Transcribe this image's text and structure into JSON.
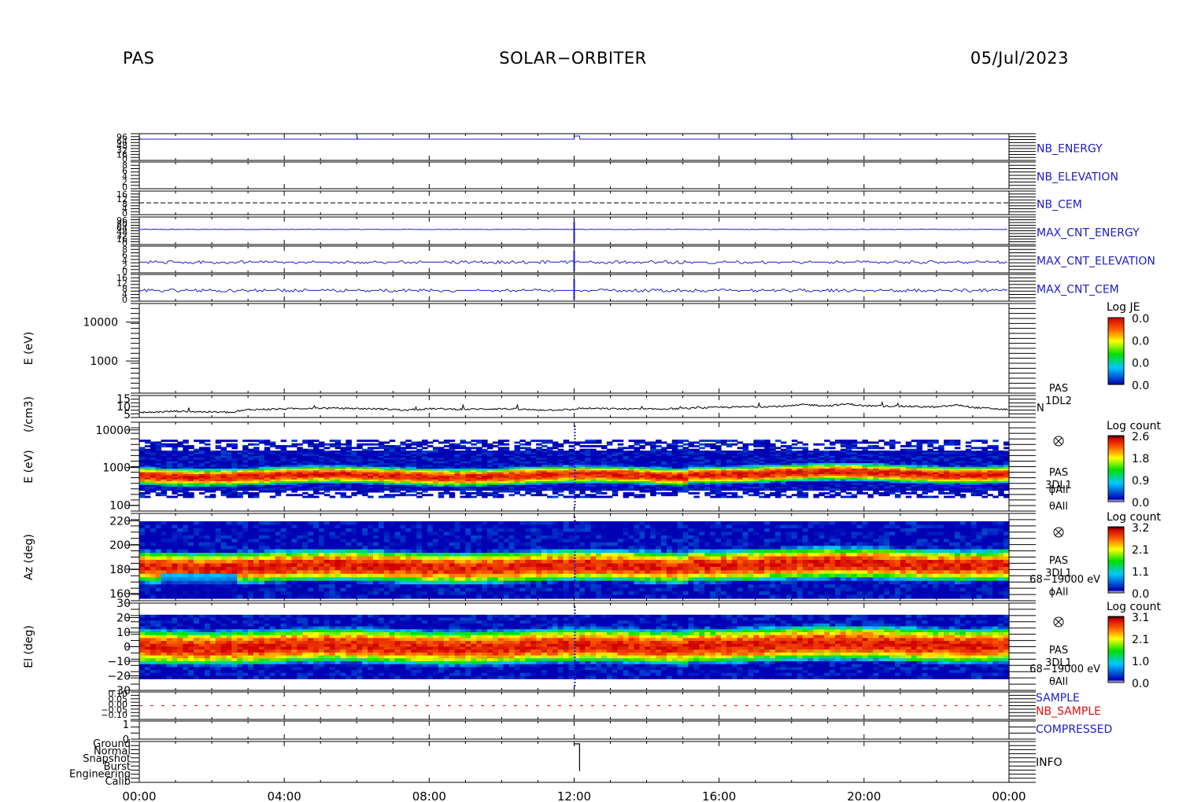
{
  "header": {
    "left": "PAS",
    "center": "SOLAR−ORBITER",
    "right": "05/Jul/2023"
  },
  "colors": {
    "blue": "#1c1cc8",
    "red": "#e01010",
    "black": "#000000"
  },
  "chart_data": {
    "type": "stacked-timeseries-spectrogram",
    "x_axis": {
      "start": "00:00",
      "end": "24:00",
      "tick_labels": [
        "00:00",
        "04:00",
        "08:00",
        "12:00",
        "16:00",
        "20:00",
        "00:00"
      ],
      "tick_hours": [
        0,
        4,
        8,
        12,
        16,
        20,
        24
      ]
    },
    "line_panels": [
      {
        "id": "nb-energy",
        "label": "NB_ENERGY",
        "label_color": "#1c1cc8",
        "ticks": [
          "96",
          "64",
          "48",
          "32",
          "16",
          "0"
        ],
        "series_color": "#1c1cc8",
        "points": [
          [
            0.0,
            1.0
          ],
          [
            0.02,
            0.0
          ],
          [
            6.0,
            0.0
          ],
          [
            6.01,
            1.0
          ],
          [
            6.02,
            0.0
          ],
          [
            12.0,
            0.0
          ],
          [
            12.01,
            1.0
          ],
          [
            12.15,
            1.0
          ],
          [
            12.16,
            0.0
          ],
          [
            18.0,
            0.0
          ],
          [
            18.01,
            1.0
          ],
          [
            18.02,
            0.0
          ],
          [
            24.0,
            0.0
          ]
        ]
      },
      {
        "id": "nb-elevation",
        "label": "NB_ELEVATION",
        "label_color": "#1c1cc8",
        "ticks": [
          "8",
          "6",
          "4",
          "2",
          "0"
        ],
        "series_color": "#1c1cc8",
        "points": []
      },
      {
        "id": "nb-cem",
        "label": "NB_CEM",
        "label_color": "#1c1cc8",
        "ticks": [
          "16",
          "12",
          "8",
          "4",
          "0"
        ],
        "series_color": "#000000",
        "dashed_level": 0.5,
        "points": []
      },
      {
        "id": "max-cnt-energy",
        "label": "MAX_CNT_ENERGY",
        "label_color": "#1c1cc8",
        "ticks": [
          "96",
          "80",
          "64",
          "48",
          "32",
          "16",
          "0"
        ],
        "series_color": "#1c1cc8",
        "base_level": 0.55,
        "spike_hour": 12.0
      },
      {
        "id": "max-cnt-elevation",
        "label": "MAX_CNT_ELEVATION",
        "label_color": "#1c1cc8",
        "ticks": [
          "8",
          "6",
          "4",
          "2",
          "0"
        ],
        "series_color": "#1c1cc8",
        "base_level": 0.4,
        "spike_hour": 12.0
      },
      {
        "id": "max-cnt-cem",
        "label": "MAX_CNT_CEM",
        "label_color": "#1c1cc8",
        "ticks": [
          "16",
          "12",
          "8",
          "4",
          "0"
        ],
        "series_color": "#1c1cc8",
        "base_level": 0.4,
        "spike_hour": 12.0
      }
    ],
    "je_panel": {
      "ylabel": "E (eV)",
      "yscale": "log",
      "ylim": [
        150,
        30000
      ],
      "ytick_labels": [
        "1000",
        "10000"
      ],
      "ytick_values": [
        1000,
        10000
      ],
      "colorbar": {
        "title": "Log JE",
        "labels": [
          "0.0",
          "0.0",
          "0.0",
          "0.0"
        ]
      }
    },
    "density_panel": {
      "ylabel": "(/cm3)",
      "ylim": [
        3,
        17
      ],
      "ytick_values": [
        5,
        10,
        15
      ],
      "ytick_labels": [
        "5",
        "10",
        "15"
      ],
      "right_labels": [
        "PAS",
        "1DL2",
        "N"
      ],
      "x": [
        0,
        1,
        2,
        2.6,
        3,
        4,
        5,
        6,
        7,
        7.3,
        8,
        9,
        10,
        11,
        12,
        12.1,
        13,
        14,
        15,
        16,
        17,
        18,
        18.3,
        19,
        19.6,
        20,
        21,
        22,
        22.6,
        23,
        24
      ],
      "y": [
        6,
        7,
        6.5,
        6.2,
        8,
        8.5,
        9,
        8.7,
        8.3,
        7.6,
        8.6,
        8.2,
        8.6,
        7.8,
        8,
        8.8,
        8.6,
        8.3,
        8.7,
        9.5,
        9.8,
        10.3,
        11.2,
        10.5,
        11.6,
        10.4,
        10.2,
        9.6,
        11,
        9.4,
        8
      ]
    },
    "spectrograms": [
      {
        "id": "energy-spectrogram",
        "ylabel": "E (eV)",
        "yscale": "log",
        "ylim": [
          70,
          16000
        ],
        "ytick_labels": [
          "100",
          "1000",
          "10000"
        ],
        "ytick_values": [
          100,
          1000,
          10000
        ],
        "right_labels": [
          "PAS",
          "3DL1",
          "ϕAll",
          "θAll"
        ],
        "colorbar": {
          "title": "Log count",
          "labels": [
            "2.6",
            "1.8",
            "0.9",
            "0.0"
          ]
        },
        "hot_band_value": 600,
        "band_top_value": 5500,
        "band_bottom_value": 160
      },
      {
        "id": "azimuth-spectrogram",
        "ylabel": "Az (deg)",
        "ylim": [
          154,
          226
        ],
        "ytick_labels": [
          "160",
          "180",
          "200",
          "220"
        ],
        "ytick_values": [
          160,
          180,
          200,
          220
        ],
        "right_labels": [
          "PAS",
          "3DL1",
          "68−19000 eV",
          "ϕAll"
        ],
        "colorbar": {
          "title": "Log count",
          "labels": [
            "3.2",
            "2.1",
            "1.1",
            "0.0"
          ]
        },
        "peak_value": 182
      },
      {
        "id": "elevation-spectrogram",
        "ylabel": "El (deg)",
        "ylim": [
          -30,
          30
        ],
        "ytick_labels": [
          "−30",
          "−20",
          "−10",
          "0",
          "10",
          "20",
          "30"
        ],
        "ytick_values": [
          -30,
          -20,
          -10,
          0,
          10,
          20,
          30
        ],
        "right_labels": [
          "PAS",
          "3DL1",
          "68−19000 eV",
          "θAll"
        ],
        "colorbar": {
          "title": "Log count",
          "labels": [
            "3.1",
            "2.1",
            "1.0",
            "0.0"
          ]
        },
        "peak_value": 0,
        "data_ylim": [
          -22,
          22
        ]
      }
    ],
    "sample_panel": {
      "labels": [
        {
          "text": "SAMPLE",
          "color": "#1c1cc8"
        },
        {
          "text": "NB_SAMPLE",
          "color": "#e01010"
        }
      ],
      "ticks": [
        "0.10",
        "0.05",
        "0.00",
        "−0.05",
        "−0.10"
      ],
      "dashed_level": 0.0
    },
    "compressed_panel": {
      "label": "COMPRESSED",
      "label_color": "#1c1cc8",
      "ticks": [
        "1",
        "0"
      ]
    },
    "info_panel": {
      "label": "INFO",
      "categories": [
        "Calib",
        "Engineering",
        "Burst",
        "Snapshot",
        "Normal",
        "Ground"
      ],
      "points": [
        [
          0,
          5
        ],
        [
          12.0,
          5
        ],
        [
          12.0,
          0
        ],
        [
          12.15,
          0
        ],
        [
          12.15,
          4
        ],
        [
          24,
          4
        ]
      ]
    }
  }
}
